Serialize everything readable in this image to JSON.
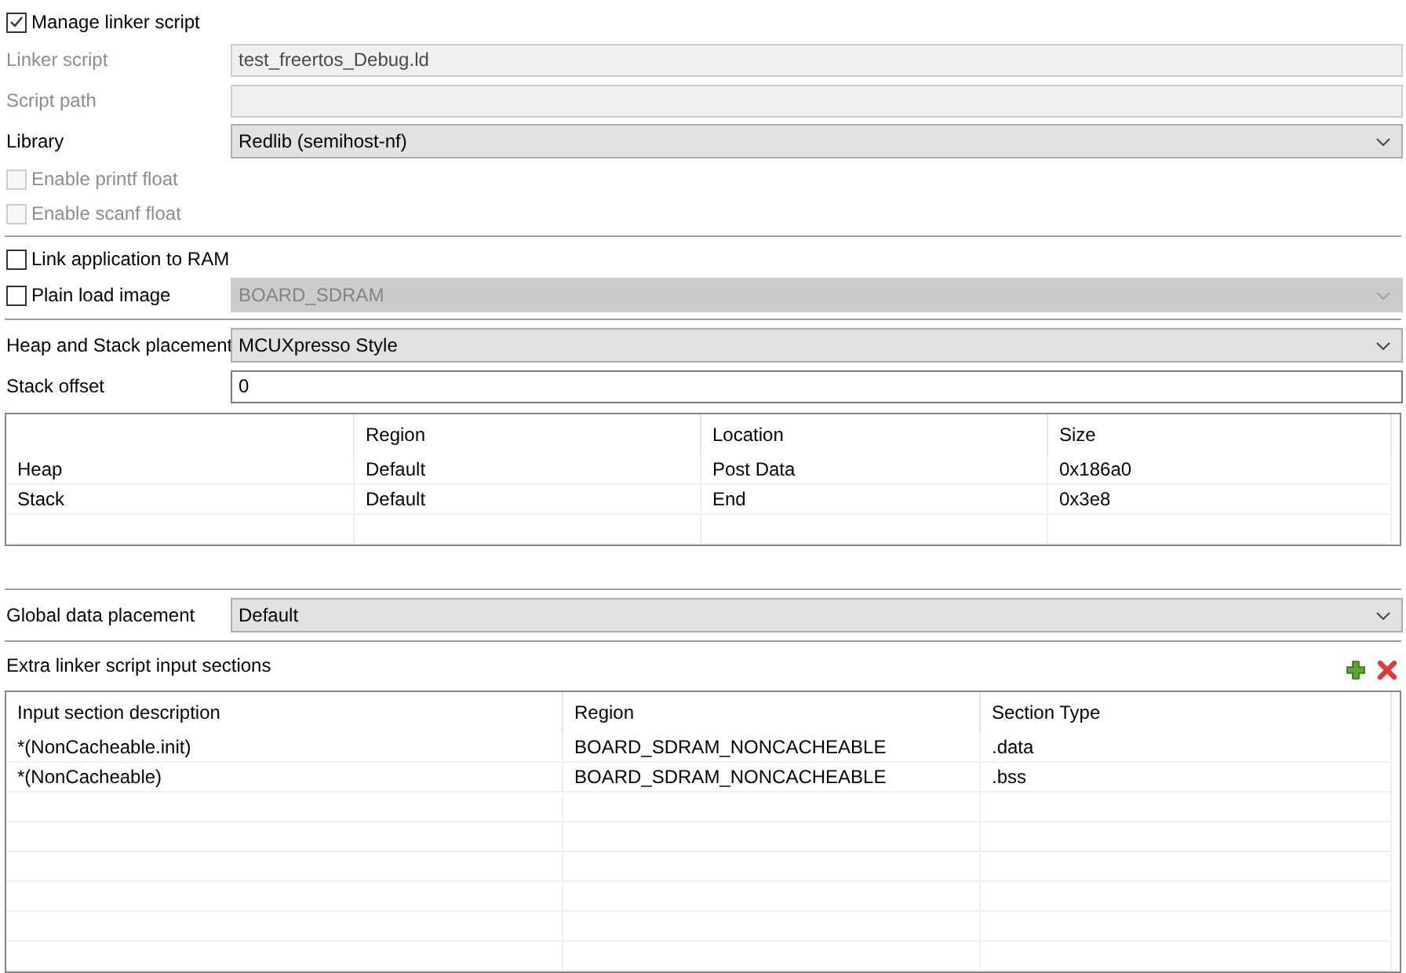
{
  "groups": [
    {
      "items": [
        {
          "kind": "checkbox",
          "label": "Manage linker script",
          "checked": true,
          "disabled": false
        },
        {
          "kind": "field",
          "label": "Linker script",
          "value": "test_freertos_Debug.ld",
          "disabled": true
        },
        {
          "kind": "field",
          "label": "Script path",
          "disabled": true
        },
        {
          "kind": "dropdown",
          "label": "Library",
          "value": "Redlib (semihost-nf)",
          "disabled": false
        },
        {
          "kind": "checkbox",
          "label": "Enable printf float",
          "checked": false,
          "disabled": true
        },
        {
          "kind": "checkbox",
          "label": "Enable scanf float",
          "checked": false,
          "disabled": true
        }
      ]
    },
    {
      "items": [
        {
          "kind": "checkbox",
          "label": "Link application to RAM",
          "checked": false,
          "disabled": false
        },
        {
          "kind": "checkbox_dropdown",
          "label": "Plain load image",
          "checked": false,
          "value": "BOARD_SDRAM",
          "disabled": true
        }
      ]
    },
    {
      "items": [
        {
          "kind": "dropdown",
          "label": "Heap and Stack placement",
          "value": "MCUXpresso Style",
          "disabled": false
        },
        {
          "kind": "field",
          "label": "Stack offset",
          "value": "0",
          "disabled": false
        },
        {
          "kind": "table",
          "columns": [
            "Region",
            "Location",
            "Size"
          ],
          "rows": [
            {
              "name": "Heap",
              "cells": [
                "Default",
                "Post Data",
                "0x186a0"
              ]
            },
            {
              "name": "Stack",
              "cells": [
                "Default",
                "End",
                "0x3e8"
              ]
            }
          ]
        }
      ]
    },
    {
      "items": [
        {
          "kind": "dropdown",
          "label": "Global data placement",
          "value": "Default",
          "disabled": false
        }
      ]
    },
    {
      "items": [
        {
          "kind": "section",
          "label": "Extra linker script input sections"
        },
        {
          "kind": "table",
          "columns": [
            "Input section description",
            "Region",
            "Section Type"
          ],
          "rows": [
            {
              "cells": [
                "*(NonCacheable.init)",
                "BOARD_SDRAM_NONCACHEABLE",
                ".data"
              ]
            },
            {
              "cells": [
                "*(NonCacheable)",
                "BOARD_SDRAM_NONCACHEABLE",
                ".bss"
              ]
            }
          ]
        }
      ]
    }
  ]
}
